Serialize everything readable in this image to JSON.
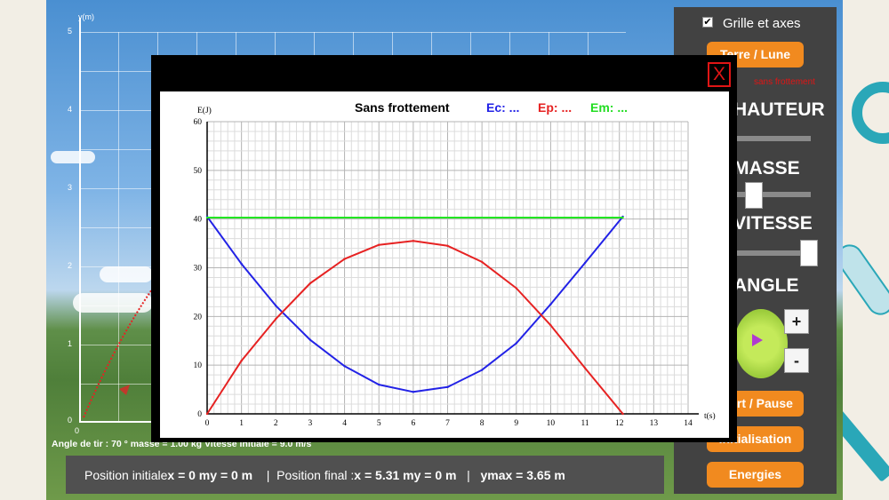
{
  "colors": {
    "ec": "#2222e6",
    "ep": "#e62222",
    "em": "#22e622",
    "panel_button": "#f18a1f",
    "close": "#e01515"
  },
  "scene": {
    "y_axis_label": "y(m)",
    "y_ticks": [
      "5",
      "4",
      "3",
      "2",
      "1",
      "0"
    ],
    "x_origin": "0",
    "info_line": "Angle de tir : 70 ° masse = 1.00 kg Vitesse initiale = 9.0 m/s"
  },
  "status": {
    "initial_label": "Position initiale",
    "initial_x": "x = 0 m",
    "initial_y": "y = 0 m",
    "final_label": "Position final :",
    "final_x": "x = 5.31 m",
    "final_y": "y = 0 m",
    "ymax": "ymax = 3.65 m"
  },
  "panel": {
    "grid_checkbox_label": "Grille et axes",
    "grid_checked": true,
    "check_glyph": "✔",
    "terre_lune_button": "Terre / Lune",
    "friction_note": "sans frottement",
    "hauteur_label": "HAUTEUR",
    "masse_label": "MASSE",
    "vitesse_label": "VITESSE",
    "angle_label": "ANGLE",
    "plus_button": "+",
    "minus_button": "-",
    "start_button": "Start / Pause",
    "init_button": "Initialisation",
    "energies_button": "Energies"
  },
  "modal": {
    "close_button": "X",
    "chart_title": "Sans frottement",
    "legend_ec": "Ec: ...",
    "legend_ep": "Ep: ...",
    "legend_em": "Em: ..."
  },
  "chart_data": {
    "type": "line",
    "title": "Sans frottement",
    "xlabel": "t(s)",
    "ylabel": "E(J)",
    "xlim": [
      0,
      14
    ],
    "ylim": [
      0,
      60
    ],
    "x_ticks": [
      "0",
      "1",
      "2",
      "3",
      "4",
      "5",
      "6",
      "7",
      "8",
      "9",
      "10",
      "11",
      "12",
      "13",
      "14"
    ],
    "y_ticks": [
      "0",
      "10",
      "20",
      "30",
      "40",
      "50",
      "60"
    ],
    "grid": true,
    "series": [
      {
        "name": "Ec: ...",
        "color": "#2222e6",
        "x": [
          0,
          1,
          2,
          3,
          4,
          5,
          6,
          7,
          8,
          9,
          10,
          11,
          12.1
        ],
        "y": [
          40.5,
          30.8,
          22.2,
          15.2,
          9.8,
          6.0,
          4.5,
          5.5,
          9.0,
          14.5,
          22.5,
          31.0,
          40.5
        ]
      },
      {
        "name": "Ep: ...",
        "color": "#e62222",
        "x": [
          0,
          1,
          2,
          3,
          4,
          5,
          6,
          7,
          8,
          9,
          10,
          11,
          12.1
        ],
        "y": [
          0,
          10.9,
          19.5,
          26.8,
          31.8,
          34.7,
          35.5,
          34.5,
          31.2,
          25.8,
          18.2,
          9.4,
          0
        ]
      },
      {
        "name": "Em: ...",
        "color": "#22e622",
        "x": [
          0,
          12.1
        ],
        "y": [
          40.3,
          40.3
        ]
      }
    ]
  }
}
